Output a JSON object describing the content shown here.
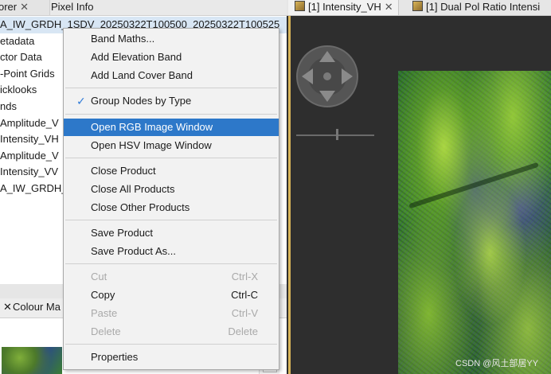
{
  "left_panel": {
    "tabs": [
      {
        "label": "orer",
        "close": "✕"
      },
      {
        "label": "Pixel Info"
      }
    ],
    "tree_rows": [
      "A_IW_GRDH_1SDV_20250322T100500_20250322T100525",
      "etadata",
      "ctor Data",
      "-Point Grids",
      "icklooks",
      "nds",
      "Amplitude_V",
      "Intensity_VH",
      "Amplitude_V",
      "Intensity_VV",
      "A_IW_GRDH_"
    ],
    "bottom_tabs": [
      {
        "label": "✕",
        "name": "close"
      },
      {
        "label": "Colour Ma",
        "name": "colour-manipulation"
      }
    ]
  },
  "image_view": {
    "tabs": [
      {
        "label": "[1] Intensity_VH",
        "close": "✕"
      },
      {
        "label": "[1] Dual Pol Ratio Intensi"
      }
    ]
  },
  "context_menu": {
    "items": [
      {
        "label": "Band Maths...",
        "shortcut": "",
        "state": "enabled"
      },
      {
        "label": "Add Elevation Band",
        "shortcut": "",
        "state": "enabled"
      },
      {
        "label": "Add Land Cover Band",
        "shortcut": "",
        "state": "enabled"
      },
      {
        "label": "Group Nodes by Type",
        "shortcut": "",
        "state": "checked"
      },
      {
        "label": "Open RGB Image Window",
        "shortcut": "",
        "state": "selected"
      },
      {
        "label": "Open HSV Image Window",
        "shortcut": "",
        "state": "enabled"
      },
      {
        "label": "Close Product",
        "shortcut": "",
        "state": "enabled"
      },
      {
        "label": "Close All Products",
        "shortcut": "",
        "state": "enabled"
      },
      {
        "label": "Close Other Products",
        "shortcut": "",
        "state": "enabled"
      },
      {
        "label": "Save Product",
        "shortcut": "",
        "state": "enabled"
      },
      {
        "label": "Save Product As...",
        "shortcut": "",
        "state": "enabled"
      },
      {
        "label": "Cut",
        "shortcut": "Ctrl-X",
        "state": "disabled"
      },
      {
        "label": "Copy",
        "shortcut": "Ctrl-C",
        "state": "enabled"
      },
      {
        "label": "Paste",
        "shortcut": "Ctrl-V",
        "state": "disabled"
      },
      {
        "label": "Delete",
        "shortcut": "Delete",
        "state": "disabled"
      },
      {
        "label": "Properties",
        "shortcut": "",
        "state": "enabled"
      }
    ],
    "check_glyph": "✓"
  },
  "watermark": "CSDN @风土部居YY",
  "colors": {
    "selection": "#2d78c9",
    "check": "#2f7bd8",
    "menu_bg": "#f2f2f2",
    "viewer_bg": "#2f2f2f",
    "window_border": "#d9b55a"
  },
  "icons": [
    "navigation-compass-icon",
    "image-window-icon",
    "checkmark-icon",
    "close-icon"
  ]
}
